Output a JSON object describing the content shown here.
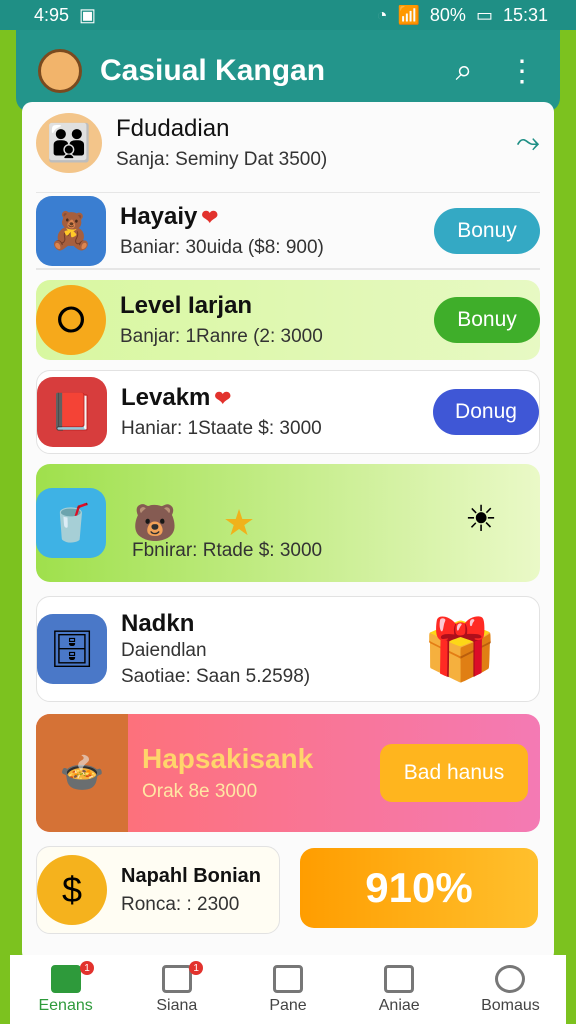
{
  "status": {
    "time_left": "4:95",
    "battery": "80%",
    "time_right": "15:31"
  },
  "app": {
    "title": "Casiual Kangan"
  },
  "list": [
    {
      "name": "Fdudadian",
      "sub": "Sanja: Seminy Dat 3500)"
    },
    {
      "name": "Hayaiy",
      "sub": "Baniar: 30uida ($8: 900)",
      "button": "Bonuy"
    },
    {
      "name": "Level Iarjan",
      "sub": "Banjar: 1Ranre (2: 3000",
      "button": "Bonuy"
    },
    {
      "name": "Levakm",
      "sub": "Haniar: 1Staate $: 3000",
      "button": "Donug"
    },
    {
      "sub": "Fbnirar: Rtade $: 3000"
    },
    {
      "name": "Nadkn",
      "sub2": "Daiendlan",
      "sub": "Saotiae: Saan 5.2598)"
    },
    {
      "name": "Hapsakisank",
      "sub": "Orak 8e 3000",
      "button": "Bad hanus"
    },
    {
      "name": "Napahl Bonian",
      "sub": "Ronca: : 2300",
      "big": "910%"
    }
  ],
  "nav": [
    {
      "label": "Eenans",
      "badge": "1"
    },
    {
      "label": "Siana",
      "badge": "1"
    },
    {
      "label": "Pane"
    },
    {
      "label": "Aniae"
    },
    {
      "label": "Bomaus"
    }
  ],
  "colors": {
    "teal": "#23958b",
    "green": "#7cc21f"
  }
}
